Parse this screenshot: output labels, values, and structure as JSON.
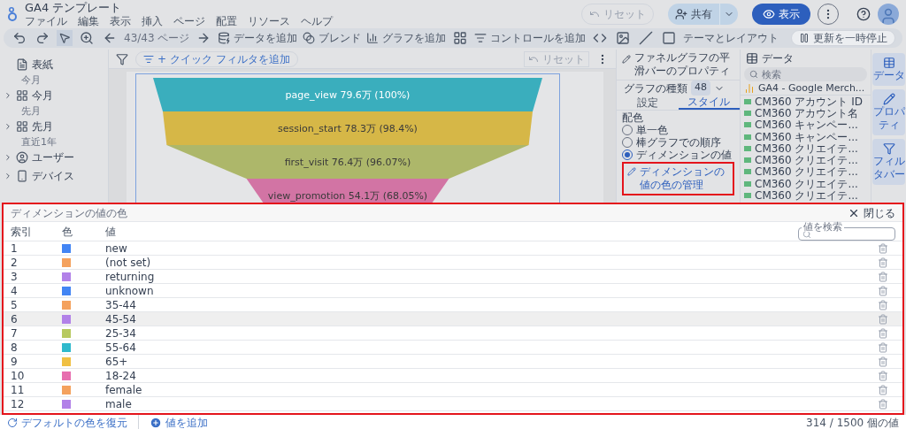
{
  "header": {
    "title": "GA4 テンプレート",
    "menu": [
      "ファイル",
      "編集",
      "表示",
      "挿入",
      "ページ",
      "配置",
      "リソース",
      "ヘルプ"
    ],
    "reset": {
      "label": "リセット",
      "disabled": true
    },
    "share": "共有",
    "view": "表示"
  },
  "toolbar": {
    "page": "43/43 ページ",
    "add_data": "データを追加",
    "blend": "ブレンド",
    "add_chart": "グラフを追加",
    "add_control": "コントロールを追加",
    "theme": "テーマとレイアウト",
    "pause": "更新を一時停止"
  },
  "sidebar": {
    "items": [
      {
        "kind": "page",
        "label": "表紙"
      },
      {
        "kind": "section",
        "label": "今月"
      },
      {
        "kind": "page",
        "label": "今月"
      },
      {
        "kind": "section",
        "label": "先月"
      },
      {
        "kind": "page",
        "label": "先月"
      },
      {
        "kind": "section",
        "label": "直近1年"
      },
      {
        "kind": "page",
        "label": "ユーザー"
      },
      {
        "kind": "page",
        "label": "デバイス"
      }
    ]
  },
  "canvas": {
    "quick_filter": "+ クイック フィルタを追加",
    "reset": "リセット",
    "funnel": [
      {
        "label": "page_view 79.6万 (100%)",
        "color": "#3aaebd"
      },
      {
        "label": "session_start 78.3万 (98.4%)",
        "color": "#d6b747"
      },
      {
        "label": "first_visit 76.4万 (96.07%)",
        "color": "#adb76a"
      },
      {
        "label": "view_promotion 54.1万 (68.05%)",
        "color": "#d274a4"
      }
    ]
  },
  "properties": {
    "title": "ファネルグラフの平滑バーのプロパティ",
    "chart_type": "グラフの種類",
    "chart_type_count": "48",
    "tabs": [
      {
        "label": "設定",
        "selected": false
      },
      {
        "label": "スタイル",
        "selected": true
      }
    ],
    "color_heading": "配色",
    "color_options": [
      {
        "label": "単一色",
        "selected": false
      },
      {
        "label": "棒グラフでの順序",
        "selected": false
      },
      {
        "label": "ディメンションの値",
        "selected": true
      }
    ],
    "manage_button": "ディメンションの値の色の管理"
  },
  "data_panel": {
    "title": "データ",
    "search_placeholder": "検索",
    "source": "GA4 - Google Merch...",
    "fields": [
      "CM360 アカウント ID",
      "CM360 アカウント名",
      "CM360 キャンペー...",
      "CM360 キャンペー...",
      "CM360 クリエイテ...",
      "CM360 クリエイテ...",
      "CM360 クリエイテ...",
      "CM360 クリエイテ...",
      "CM360 クリエイテ..."
    ]
  },
  "rail": [
    {
      "label": "データ"
    },
    {
      "label": "プロパティ"
    },
    {
      "label": "フィルタバー"
    }
  ],
  "color_dialog": {
    "title": "ディメンションの値の色",
    "close": "閉じる",
    "columns": [
      "索引",
      "色",
      "値"
    ],
    "search_label": "値を検索",
    "rows": [
      {
        "index": "1",
        "color": "#4285f4",
        "value": "new",
        "hovered": false
      },
      {
        "index": "2",
        "color": "#f4a15d",
        "value": "(not set)",
        "hovered": false
      },
      {
        "index": "3",
        "color": "#b281e8",
        "value": "returning",
        "hovered": false
      },
      {
        "index": "4",
        "color": "#4285f4",
        "value": "unknown",
        "hovered": false
      },
      {
        "index": "5",
        "color": "#f4a15d",
        "value": "35-44",
        "hovered": false
      },
      {
        "index": "6",
        "color": "#b281e8",
        "value": "45-54",
        "hovered": true
      },
      {
        "index": "7",
        "color": "#b7c95f",
        "value": "25-34",
        "hovered": false
      },
      {
        "index": "8",
        "color": "#2fb9cc",
        "value": "55-64",
        "hovered": false
      },
      {
        "index": "9",
        "color": "#f0c043",
        "value": "65+",
        "hovered": false
      },
      {
        "index": "10",
        "color": "#e76eaf",
        "value": "18-24",
        "hovered": false
      },
      {
        "index": "11",
        "color": "#f4a15d",
        "value": "female",
        "hovered": false
      },
      {
        "index": "12",
        "color": "#b281e8",
        "value": "male",
        "hovered": false
      }
    ],
    "restore": "デフォルトの色を復元",
    "add_value": "値を追加",
    "count": "314 / 1500 個の値"
  }
}
